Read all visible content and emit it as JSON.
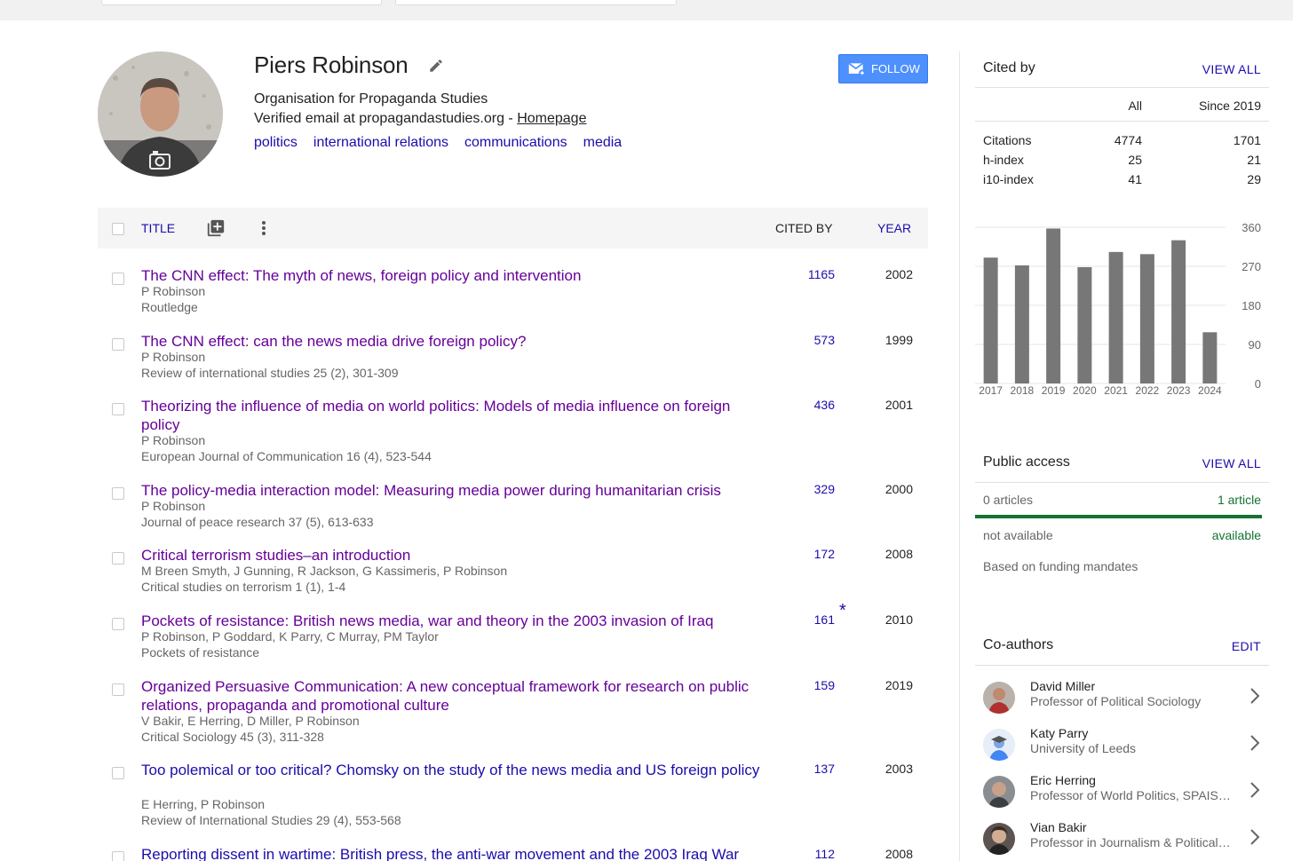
{
  "profile": {
    "name": "Piers Robinson",
    "affiliation": "Organisation for Propaganda Studies",
    "email_prefix": "Verified email at propagandastudies.org - ",
    "homepage_label": "Homepage",
    "interests": [
      "politics",
      "international relations",
      "communications",
      "media"
    ],
    "follow_label": "FOLLOW"
  },
  "table": {
    "header": {
      "title": "TITLE",
      "cited_by": "CITED BY",
      "year": "YEAR"
    },
    "rows": [
      {
        "title": "The CNN effect: The myth of news, foreign policy and intervention",
        "authors": "P Robinson",
        "venue": "Routledge",
        "cited_by": "1165",
        "year": "2002"
      },
      {
        "title": "The CNN effect: can the news media drive foreign policy?",
        "authors": "P Robinson",
        "venue": "Review of international studies 25 (2), 301-309",
        "cited_by": "573",
        "year": "1999"
      },
      {
        "title": "Theorizing the influence of media on world politics: Models of media influence on foreign policy",
        "authors": "P Robinson",
        "venue": "European Journal of Communication 16 (4), 523-544",
        "cited_by": "436",
        "year": "2001"
      },
      {
        "title": "The policy-media interaction model: Measuring media power during humanitarian crisis",
        "authors": "P Robinson",
        "venue": "Journal of peace research 37 (5), 613-633",
        "cited_by": "329",
        "year": "2000"
      },
      {
        "title": "Critical terrorism studies–an introduction",
        "authors": "M Breen Smyth, J Gunning, R Jackson, G Kassimeris, P Robinson",
        "venue": "Critical studies on terrorism 1 (1), 1-4",
        "cited_by": "172",
        "year": "2008"
      },
      {
        "title": "Pockets of resistance: British news media, war and theory in the 2003 invasion of Iraq",
        "authors": "P Robinson, P Goddard, K Parry, C Murray, PM Taylor",
        "venue": "Pockets of resistance",
        "cited_by": "161",
        "marker": "*",
        "year": "2010"
      },
      {
        "title": "Organized Persuasive Communication: A new conceptual framework for research on public relations, propaganda and promotional culture",
        "authors": "V Bakir, E Herring, D Miller, P Robinson",
        "venue": "Critical Sociology 45 (3), 311-328",
        "cited_by": "159",
        "year": "2019"
      },
      {
        "title": "Too polemical or too critical? Chomsky on the study of the news media and US foreign policy",
        "authors": "E Herring, P Robinson",
        "venue": "Review of International Studies 29 (4), 553-568",
        "cited_by": "137",
        "year": "2003"
      },
      {
        "title": "Reporting dissent in wartime: British press, the anti-war movement and the 2003 Iraq War",
        "authors": "",
        "venue": "",
        "cited_by": "112",
        "year": "2008"
      }
    ]
  },
  "cited_by": {
    "heading": "Cited by",
    "view_all": "VIEW ALL",
    "col_all": "All",
    "col_since": "Since 2019",
    "stats": [
      {
        "label": "Citations",
        "all": "4774",
        "since": "1701"
      },
      {
        "label": "h-index",
        "all": "25",
        "since": "21"
      },
      {
        "label": "i10-index",
        "all": "41",
        "since": "29"
      }
    ]
  },
  "chart_data": {
    "type": "bar",
    "categories": [
      "2017",
      "2018",
      "2019",
      "2020",
      "2021",
      "2022",
      "2023",
      "2024"
    ],
    "values": [
      290,
      272,
      357,
      268,
      303,
      298,
      330,
      118
    ],
    "yticks": [
      "360",
      "270",
      "180",
      "90",
      "0"
    ],
    "ylim": [
      0,
      360
    ],
    "bar_color": "#777777",
    "grid": true
  },
  "public_access": {
    "heading": "Public access",
    "view_all": "VIEW ALL",
    "left_count": "0 articles",
    "right_count": "1 article",
    "left_status": "not available",
    "right_status": "available",
    "note": "Based on funding mandates"
  },
  "coauthors": {
    "heading": "Co-authors",
    "edit": "EDIT",
    "items": [
      {
        "name": "David Miller",
        "affiliation": "Professor of Political Sociology"
      },
      {
        "name": "Katy Parry",
        "affiliation": "University of Leeds"
      },
      {
        "name": "Eric Herring",
        "affiliation": "Professor of World Politics, SPAIS, University of Bristol"
      },
      {
        "name": "Vian Bakir",
        "affiliation": "Professor in Journalism & Political Communication"
      }
    ]
  },
  "colors": {
    "link": "#1a0dab",
    "visited": "#660099",
    "follow": "#4d90fe",
    "green": "#137333"
  }
}
